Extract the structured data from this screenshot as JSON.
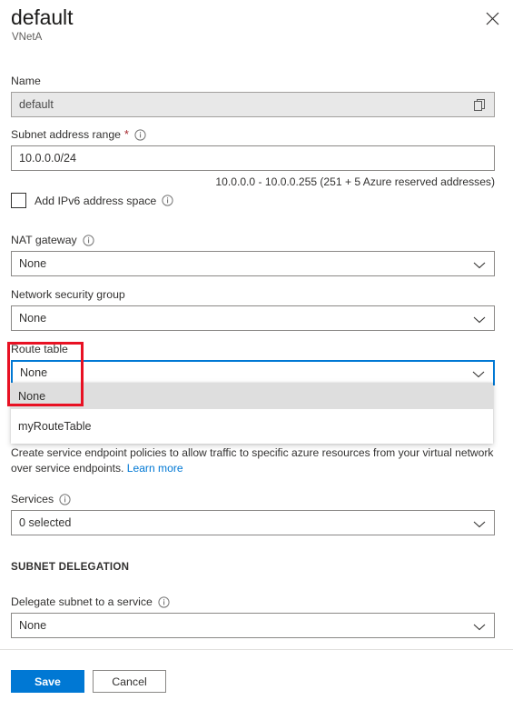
{
  "header": {
    "title": "default",
    "subtitle": "VNetA",
    "close_label": "Close",
    "close_icon": "close-icon"
  },
  "form": {
    "name": {
      "label": "Name",
      "value": "default",
      "copy_icon": "copy-icon"
    },
    "subnet_address_range": {
      "label": "Subnet address range",
      "required_marker": "*",
      "info_icon": "info-icon",
      "value": "10.0.0.0/24",
      "hint": "10.0.0.0 - 10.0.0.255 (251 + 5 Azure reserved addresses)"
    },
    "ipv6_checkbox": {
      "label": "Add IPv6 address space",
      "checked": false,
      "info_icon": "info-icon"
    },
    "nat_gateway": {
      "label": "NAT gateway",
      "info_icon": "info-icon",
      "value": "None",
      "chevron_icon": "chevron-down-icon"
    },
    "network_security_group": {
      "label": "Network security group",
      "value": "None",
      "chevron_icon": "chevron-down-icon"
    },
    "route_table": {
      "label": "Route table",
      "value": "None",
      "chevron_icon": "chevron-down-icon",
      "expanded": true,
      "options": [
        {
          "label": "None",
          "highlighted": true
        },
        {
          "label": "myRouteTable",
          "highlighted": false
        }
      ]
    },
    "service_endpoints": {
      "description": "Create service endpoint policies to allow traffic to specific azure resources from your virtual network over service endpoints.",
      "link_label": "Learn more"
    },
    "services": {
      "label": "Services",
      "info_icon": "info-icon",
      "value": "0 selected",
      "chevron_icon": "chevron-down-icon"
    },
    "subnet_delegation": {
      "section_title": "SUBNET DELEGATION",
      "delegate_label": "Delegate subnet to a service",
      "info_icon": "info-icon",
      "value": "None",
      "chevron_icon": "chevron-down-icon"
    }
  },
  "footer": {
    "save_label": "Save",
    "cancel_label": "Cancel"
  },
  "annotation": {
    "color": "#e81123",
    "target": "route-table-none-option"
  }
}
